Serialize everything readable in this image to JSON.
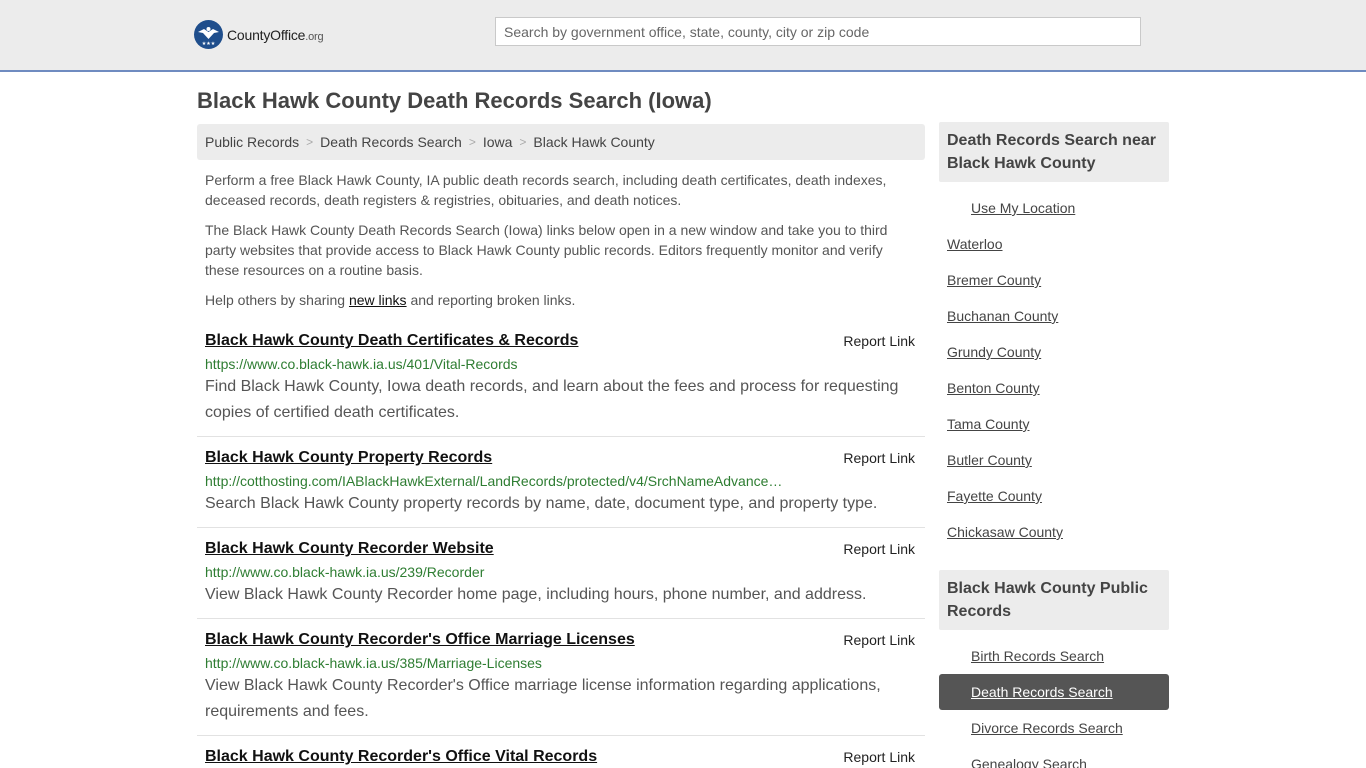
{
  "header": {
    "logo_main": "CountyOffice",
    "logo_org": ".org",
    "search_placeholder": "Search by government office, state, county, city or zip code"
  },
  "page_title": "Black Hawk County Death Records Search (Iowa)",
  "breadcrumb": [
    "Public Records",
    "Death Records Search",
    "Iowa",
    "Black Hawk County"
  ],
  "intro": {
    "p1": "Perform a free Black Hawk County, IA public death records search, including death certificates, death indexes, deceased records, death registers & registries, obituaries, and death notices.",
    "p2": "The Black Hawk County Death Records Search (Iowa) links below open in a new window and take you to third party websites that provide access to Black Hawk County public records. Editors frequently monitor and verify these resources on a routine basis.",
    "p3_before": "Help others by sharing ",
    "p3_link": "new links",
    "p3_after": " and reporting broken links."
  },
  "report_label": "Report Link",
  "listings": [
    {
      "title": "Black Hawk County Death Certificates & Records",
      "url": "https://www.co.black-hawk.ia.us/401/Vital-Records",
      "desc": "Find Black Hawk County, Iowa death records, and learn about the fees and process for requesting copies of certified death certificates."
    },
    {
      "title": "Black Hawk County Property Records",
      "url": "http://cotthosting.com/IABlackHawkExternal/LandRecords/protected/v4/SrchNameAdvance…",
      "desc": "Search Black Hawk County property records by name, date, document type, and property type."
    },
    {
      "title": "Black Hawk County Recorder Website",
      "url": "http://www.co.black-hawk.ia.us/239/Recorder",
      "desc": "View Black Hawk County Recorder home page, including hours, phone number, and address."
    },
    {
      "title": "Black Hawk County Recorder's Office Marriage Licenses",
      "url": "http://www.co.black-hawk.ia.us/385/Marriage-Licenses",
      "desc": "View Black Hawk County Recorder's Office marriage license information regarding applications, requirements and fees."
    },
    {
      "title": "Black Hawk County Recorder's Office Vital Records",
      "url": "",
      "desc": ""
    }
  ],
  "sidebar": {
    "near_heading": "Death Records Search near Black Hawk County",
    "use_location": "Use My Location",
    "near_items": [
      "Waterloo",
      "Bremer County",
      "Buchanan County",
      "Grundy County",
      "Benton County",
      "Tama County",
      "Butler County",
      "Fayette County",
      "Chickasaw County"
    ],
    "public_heading": "Black Hawk County Public Records",
    "public_items": [
      "Birth Records Search",
      "Death Records Search",
      "Divorce Records Search",
      "Genealogy Search"
    ],
    "active_item": "Death Records Search"
  },
  "colors": {
    "header_bg": "#ececec",
    "header_border": "#6f8bc0",
    "url_green": "#2e7d32",
    "active_bg": "#555555",
    "logo_blue": "#1f4e8c"
  }
}
